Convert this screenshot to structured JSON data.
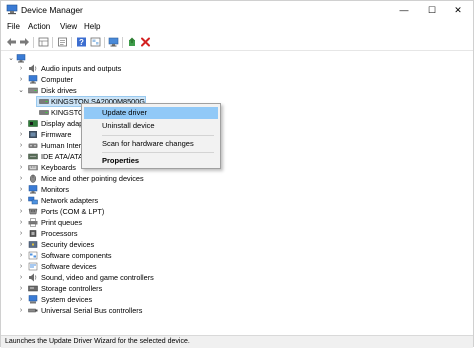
{
  "window": {
    "title": "Device Manager",
    "minimize": "—",
    "maximize": "☐",
    "close": "✕"
  },
  "menu": [
    "File",
    "Action",
    "View",
    "Help"
  ],
  "toolbar_icons": [
    "back-arrow-icon",
    "forward-arrow-icon",
    "properties-grid-icon",
    "driver-details-icon",
    "help-icon",
    "show-hidden-icon",
    "monitor-scan-icon",
    "update-driver-icon",
    "uninstall-x-icon"
  ],
  "tree": {
    "root_icon": "computer-icon",
    "items": [
      {
        "label": "Audio inputs and outputs",
        "icon": "speaker-icon",
        "state": "collapsed"
      },
      {
        "label": "Computer",
        "icon": "monitor-icon",
        "state": "collapsed"
      },
      {
        "label": "Disk drives",
        "icon": "disk-icon",
        "state": "expanded"
      },
      {
        "label": "KINGSTON SA2000M8500G",
        "icon": "drive-icon",
        "state": "child-selected"
      },
      {
        "label": "KINGSTO",
        "icon": "drive-icon",
        "state": "child"
      },
      {
        "label": "Display adap",
        "icon": "display-adapter-icon",
        "state": "collapsed"
      },
      {
        "label": "Firmware",
        "icon": "firmware-icon",
        "state": "collapsed"
      },
      {
        "label": "Human Inter",
        "icon": "hid-icon",
        "state": "collapsed"
      },
      {
        "label": "IDE ATA/ATA",
        "icon": "ide-icon",
        "state": "collapsed"
      },
      {
        "label": "Keyboards",
        "icon": "keyboard-icon",
        "state": "collapsed"
      },
      {
        "label": "Mice and other pointing devices",
        "icon": "mouse-icon",
        "state": "collapsed"
      },
      {
        "label": "Monitors",
        "icon": "monitor-icon",
        "state": "collapsed"
      },
      {
        "label": "Network adapters",
        "icon": "network-icon",
        "state": "collapsed"
      },
      {
        "label": "Ports (COM & LPT)",
        "icon": "port-icon",
        "state": "collapsed"
      },
      {
        "label": "Print queues",
        "icon": "printer-icon",
        "state": "collapsed"
      },
      {
        "label": "Processors",
        "icon": "processor-icon",
        "state": "collapsed"
      },
      {
        "label": "Security devices",
        "icon": "security-icon",
        "state": "collapsed"
      },
      {
        "label": "Software components",
        "icon": "software-icon",
        "state": "collapsed"
      },
      {
        "label": "Software devices",
        "icon": "software-icon",
        "state": "collapsed"
      },
      {
        "label": "Sound, video and game controllers",
        "icon": "speaker-icon",
        "state": "collapsed"
      },
      {
        "label": "Storage controllers",
        "icon": "storage-icon",
        "state": "collapsed"
      },
      {
        "label": "System devices",
        "icon": "system-icon",
        "state": "collapsed"
      },
      {
        "label": "Universal Serial Bus controllers",
        "icon": "usb-icon",
        "state": "collapsed"
      }
    ]
  },
  "context_menu": {
    "items": [
      "Update driver",
      "Uninstall device",
      "Scan for hardware changes",
      "Properties"
    ],
    "highlighted": "Update driver"
  },
  "status_bar": {
    "text": "Launches the Update Driver Wizard for the selected device."
  },
  "colors": {
    "selection": "#cce4f7",
    "menu_highlight": "#91c9f7",
    "context_bg": "#f2f2f2"
  }
}
